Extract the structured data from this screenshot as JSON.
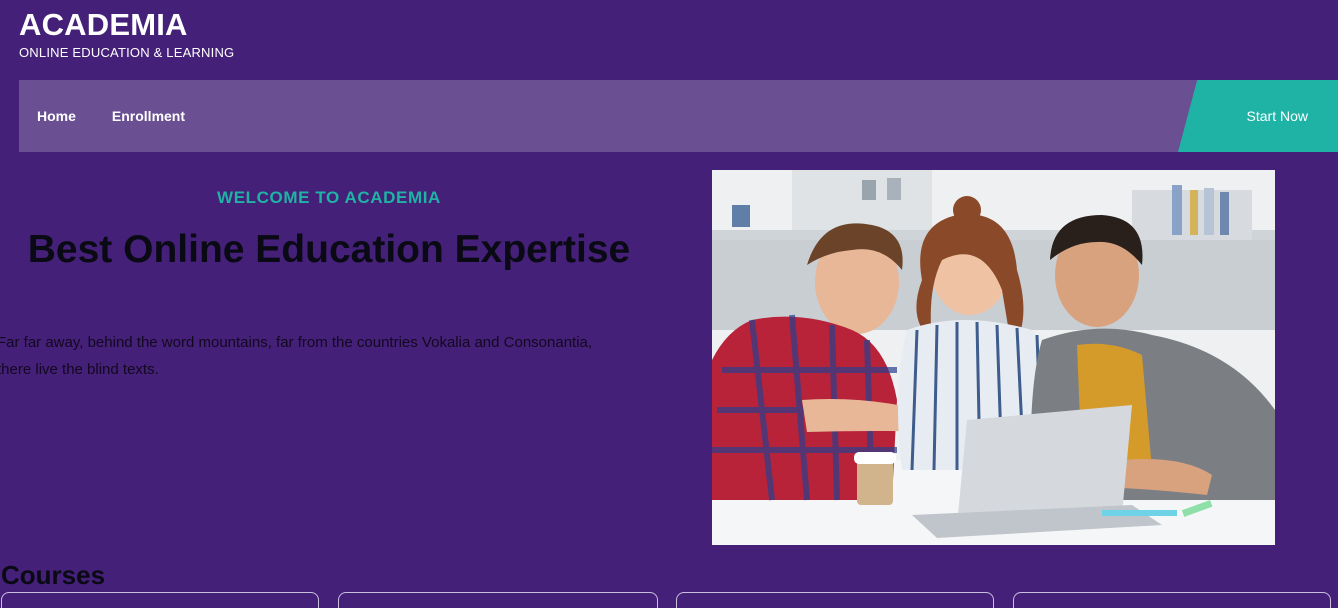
{
  "brand": {
    "title": "ACADEMIA",
    "subtitle": "ONLINE EDUCATION & LEARNING"
  },
  "nav": {
    "items": [
      {
        "label": "Home"
      },
      {
        "label": "Enrollment"
      }
    ],
    "cta_label": "Start Now"
  },
  "hero": {
    "eyebrow": "WELCOME TO ACADEMIA",
    "title": "Best Online Education Expertise",
    "text_line1": "Far far away, behind the word mountains, far from the countries Vokalia and Consonantia,",
    "text_line2": "there live the blind texts.",
    "image_icon": "students-laptop-photo"
  },
  "courses": {
    "heading": "Courses",
    "card_count_visible": 4
  },
  "colors": {
    "background": "#452078",
    "nav": "#6a4f93",
    "accent": "#1fb3a5"
  }
}
